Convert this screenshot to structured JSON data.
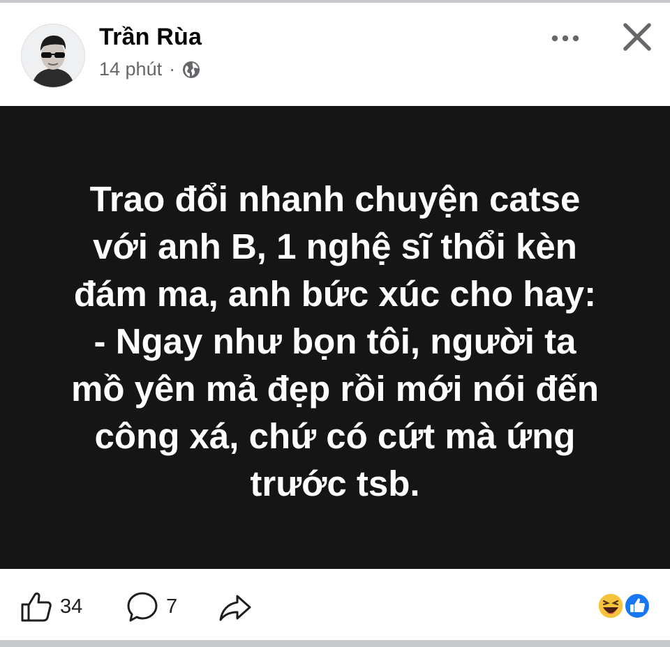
{
  "post": {
    "author": "Trần Rùa",
    "time": "14 phút",
    "separator": "·",
    "privacy_icon": "globe-icon",
    "text": "Trao đổi nhanh chuyện catse\nvới anh B, 1 nghệ sĩ thổi kèn\nđám ma, anh bức xúc cho hay:\n- Ngay như bọn tôi, người ta\nmồ yên mả đẹp rồi mới nói đến\ncông xá, chứ có cứt mà ứng\ntrước tsb.",
    "background_color": "#151515"
  },
  "header_actions": {
    "more_icon": "more-horizontal-icon",
    "close_icon": "close-icon"
  },
  "footer": {
    "likes": "34",
    "comments": "7",
    "like_icon": "like-icon",
    "comment_icon": "comment-icon",
    "share_icon": "share-icon",
    "reactions": [
      "haha-reaction-icon",
      "like-reaction-icon"
    ]
  }
}
